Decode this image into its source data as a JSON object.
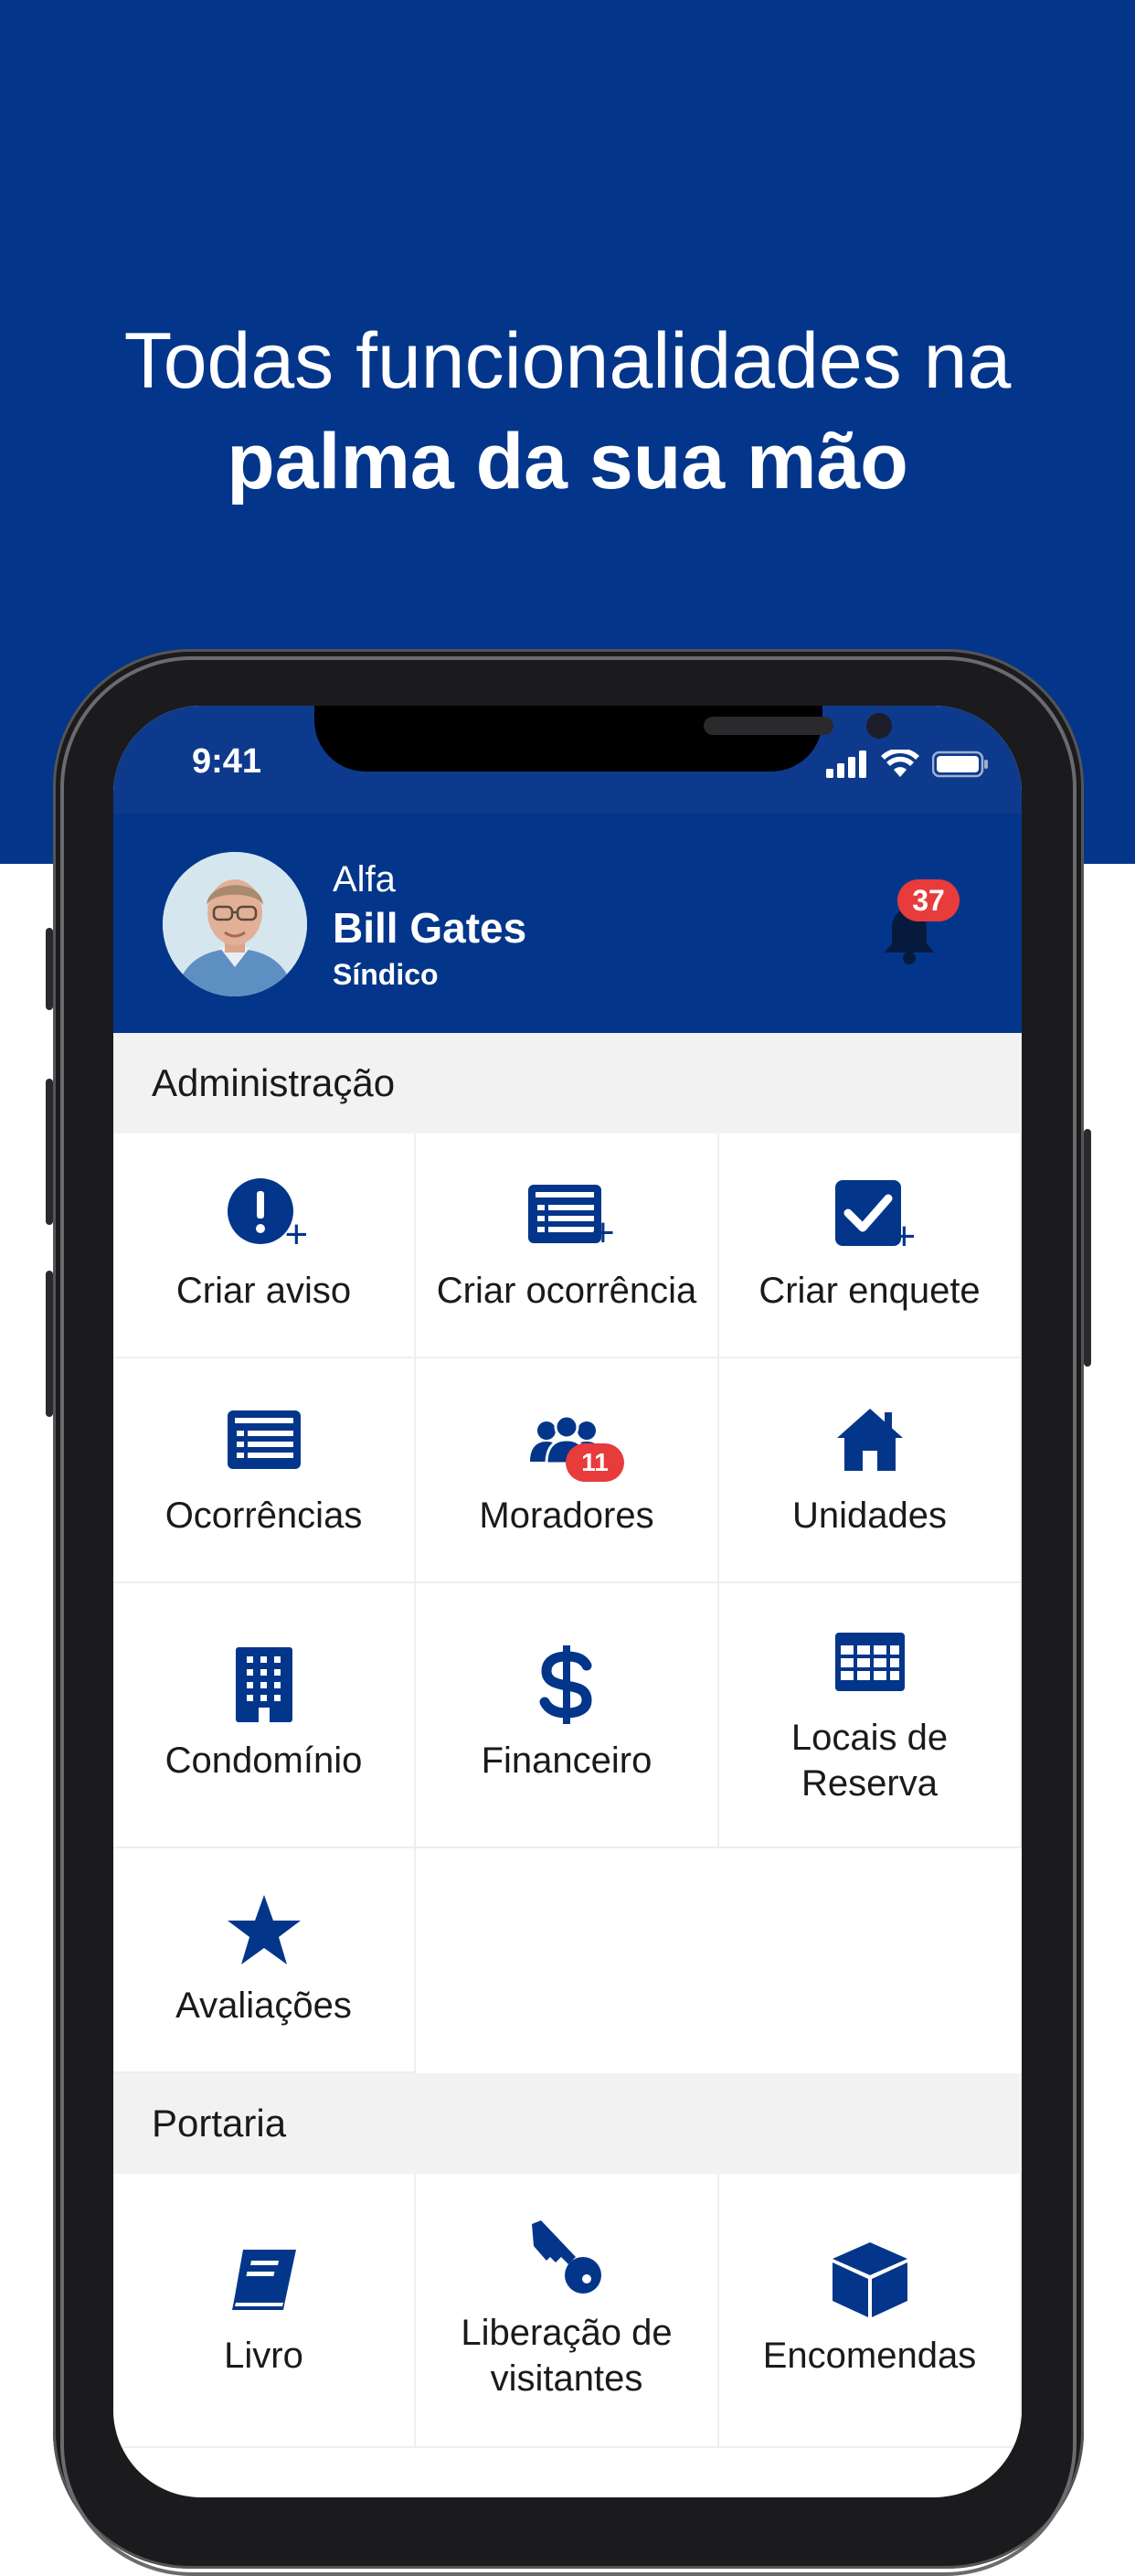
{
  "headline": {
    "line1": "Todas funcionalidades na",
    "line2": "palma da sua mão"
  },
  "status_bar": {
    "time": "9:41"
  },
  "colors": {
    "brand": "#03368a",
    "badge": "#e83b3b",
    "section_bg": "#f2f2f2"
  },
  "profile": {
    "org": "Alfa",
    "name": "Bill Gates",
    "role": "Síndico",
    "notifications": "37"
  },
  "administracao": {
    "title": "Administração",
    "items": [
      {
        "label": "Criar aviso",
        "icon": "alert-plus-icon"
      },
      {
        "label": "Criar ocorrência",
        "icon": "list-plus-icon"
      },
      {
        "label": "Criar enquete",
        "icon": "check-plus-icon"
      },
      {
        "label": "Ocorrências",
        "icon": "list-icon"
      },
      {
        "label": "Moradores",
        "icon": "users-icon",
        "badge": "11"
      },
      {
        "label": "Unidades",
        "icon": "home-icon"
      },
      {
        "label": "Condomínio",
        "icon": "building-icon"
      },
      {
        "label": "Financeiro",
        "icon": "dollar-icon"
      },
      {
        "label": "Locais de Reserva",
        "icon": "calendar-grid-icon"
      },
      {
        "label": "Avaliações",
        "icon": "star-icon"
      }
    ]
  },
  "portaria": {
    "title": "Portaria",
    "items": [
      {
        "label": "Livro",
        "icon": "book-icon"
      },
      {
        "label": "Liberação de visitantes",
        "icon": "key-icon"
      },
      {
        "label": "Encomendas",
        "icon": "box-icon"
      }
    ]
  }
}
